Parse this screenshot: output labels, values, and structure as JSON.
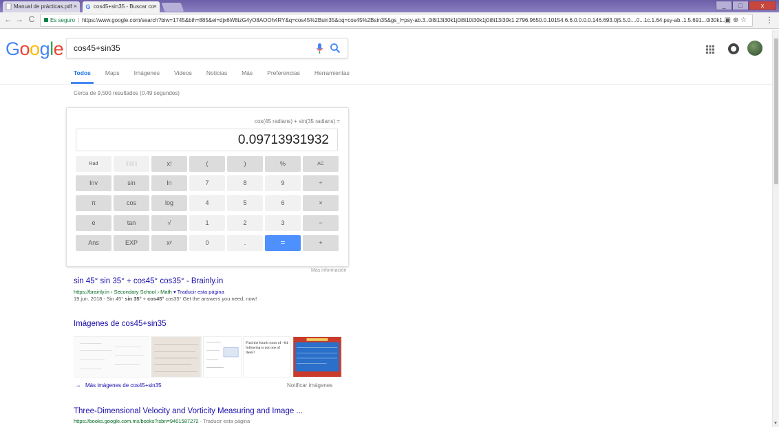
{
  "browser": {
    "tabs": [
      {
        "title": "Manual de prácticas.pdf",
        "close": "×"
      },
      {
        "title": "cos45+sin35 - Buscar co",
        "close": "×"
      }
    ],
    "window_controls": [
      "_",
      "□",
      "x"
    ],
    "secure_label": "Es seguro",
    "url": "https://www.google.com/search?biw=1745&bih=885&ei=djx6W8izG4yO8AOOh4RY&q=cos45%2Bsin35&oq=cos45%2Bsin35&gs_l=psy-ab.3..0i8i13i30k1j0i8i10i30k1j0i8i13i30k1.2796.9650.0.10154.6.6.0.0.0.0.146.693.0j5.5.0....0...1c.1.64.psy-ab..1.5.691...0i30k1..."
  },
  "google": {
    "logo": "Google",
    "query": "cos45+sin35",
    "tabs": [
      "Todos",
      "Maps",
      "Imágenes",
      "Videos",
      "Noticias",
      "Más",
      "Preferencias",
      "Herramientas"
    ],
    "stats": "Cerca de 9,500 resultados (0.49 segundos)"
  },
  "calculator": {
    "expression": "cos(45 radians) + sin(35 radians) =",
    "display": "0.09713931932",
    "keys": [
      [
        "Rad",
        "|||||||||",
        "x!",
        "(",
        ")",
        "%",
        "AC"
      ],
      [
        "Inv",
        "sin",
        "ln",
        "7",
        "8",
        "9",
        "÷"
      ],
      [
        "π",
        "cos",
        "log",
        "4",
        "5",
        "6",
        "×"
      ],
      [
        "e",
        "tan",
        "√",
        "1",
        "2",
        "3",
        "−"
      ],
      [
        "Ans",
        "EXP",
        "xʸ",
        "0",
        ".",
        "=",
        "+"
      ]
    ],
    "more_info": "Más información"
  },
  "results": [
    {
      "title": "sin 45° sin 35° + cos45° cos35° - Brainly.in",
      "url": "https://brainly.in › Secondary School › Math",
      "translate": "▾ Traducir esta página",
      "snippet_pre": "19 jun. 2018 - Sin 45° ",
      "snippet_b1": "sin 35°",
      "snippet_mid": " + ",
      "snippet_b2": "cos45°",
      "snippet_post": " cos35° Get the answers you need, now!"
    },
    {
      "title": "Three-Dimensional Velocity and Vorticity Measuring and Image ...",
      "url": "https://books.google.com.mx/books?isbn=9401587272",
      "translate": " - Traducir esta página"
    }
  ],
  "images": {
    "heading": "Imágenes de cos45+sin35",
    "thumb_caption": "Find the fourth roots of −64 following is not one of them?",
    "more": "Más imágenes de cos45+sin35",
    "report": "Notificar imágenes"
  },
  "colors": {
    "link": "#1a0dab",
    "url_green": "#006621",
    "accent_blue": "#4285f4",
    "equals_key": "#4d90fe"
  }
}
